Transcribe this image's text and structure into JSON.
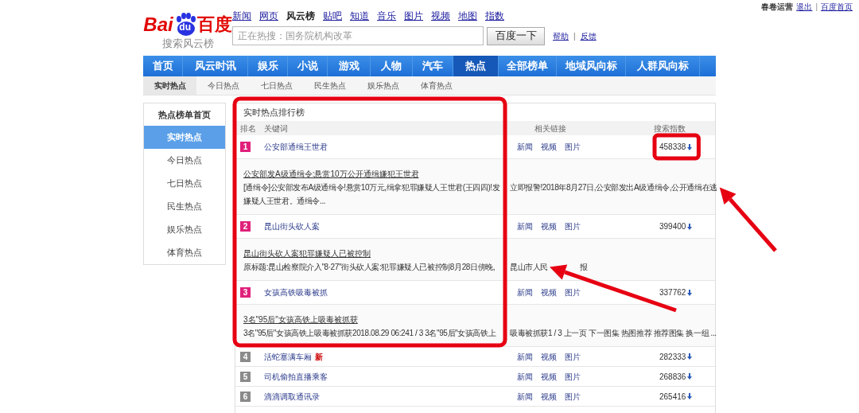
{
  "user_bar": {
    "user": "春卷运营",
    "links": [
      "退出",
      "百度首页"
    ],
    "separator": "|"
  },
  "logo": {
    "left": "Bai",
    "paw": "du",
    "right": "百度",
    "subtitle": "搜索风云榜"
  },
  "top_links": [
    {
      "label": "新闻",
      "selected": false
    },
    {
      "label": "网页",
      "selected": false
    },
    {
      "label": "风云榜",
      "selected": true
    },
    {
      "label": "贴吧",
      "selected": false
    },
    {
      "label": "知道",
      "selected": false
    },
    {
      "label": "音乐",
      "selected": false
    },
    {
      "label": "图片",
      "selected": false
    },
    {
      "label": "视频",
      "selected": false
    },
    {
      "label": "地图",
      "selected": false
    },
    {
      "label": "指数",
      "selected": false
    }
  ],
  "search": {
    "placeholder": "正在热搜：国务院机构改革",
    "button": "百度一下",
    "links": [
      "帮助",
      "反馈"
    ],
    "separator": "|"
  },
  "nav": [
    {
      "label": "首页",
      "selected": false
    },
    {
      "label": "风云时讯",
      "selected": false
    },
    {
      "label": "娱乐",
      "selected": false
    },
    {
      "label": "小说",
      "selected": false
    },
    {
      "label": "游戏",
      "selected": false
    },
    {
      "label": "人物",
      "selected": false
    },
    {
      "label": "汽车",
      "selected": false
    },
    {
      "label": "热点",
      "selected": true
    },
    {
      "label": "全部榜单",
      "selected": false
    },
    {
      "label": "地域风向标",
      "selected": false
    },
    {
      "label": "人群风向标",
      "selected": false
    }
  ],
  "subnav": [
    {
      "label": "实时热点",
      "selected": true
    },
    {
      "label": "今日热点",
      "selected": false
    },
    {
      "label": "七日热点",
      "selected": false
    },
    {
      "label": "民生热点",
      "selected": false
    },
    {
      "label": "娱乐热点",
      "selected": false
    },
    {
      "label": "体育热点",
      "selected": false
    }
  ],
  "sidebar": {
    "title": "热点榜单首页",
    "items": [
      {
        "label": "实时热点",
        "selected": true
      },
      {
        "label": "今日热点",
        "selected": false
      },
      {
        "label": "七日热点",
        "selected": false
      },
      {
        "label": "民生热点",
        "selected": false
      },
      {
        "label": "娱乐热点",
        "selected": false
      },
      {
        "label": "体育热点",
        "selected": false
      }
    ]
  },
  "ranking": {
    "title": "实时热点排行榜",
    "columns": [
      "排名",
      "关键词",
      "相关链接",
      "搜索指数"
    ],
    "rows": [
      {
        "rank": "1",
        "highlighted": true,
        "keyword": "公安部通缉王世君",
        "links": [
          "新闻",
          "视频",
          "图片"
        ],
        "index": "458338",
        "detail": {
          "title": "公安部发A级通缉令:悬赏10万公开通缉嫌犯王世君",
          "lines": [
            [
              "[通缉令]公安部发布A级通缉令!悬赏10万元,缉拿犯罪嫌疑人王世君(王四四)!发",
              "立即报警!2018年8月27日,公安部发出A级通缉令,公开通缉在逃"
            ],
            [
              "嫌疑人王世君。通缉令..."
            ]
          ]
        }
      },
      {
        "rank": "2",
        "highlighted": true,
        "keyword": "昆山街头砍人案",
        "links": [
          "新闻",
          "视频",
          "图片"
        ],
        "index": "399400",
        "detail": {
          "title": "昆山街头砍人案犯罪嫌疑人已被控制",
          "lines": [
            [
              "原标题:昆山检察院介入\"8·27\"街头砍人案:犯罪嫌疑人已被控制8月28日傍晚,",
              "昆山市人民",
              "报"
            ]
          ]
        }
      },
      {
        "rank": "3",
        "highlighted": true,
        "keyword": "女孩高铁吸毒被抓",
        "links": [
          "新闻",
          "视频",
          "图片"
        ],
        "index": "337762",
        "detail": {
          "title": "3名\"95后\"女孩高铁上吸毒被抓获",
          "lines": [
            [
              "3名\"95后\"女孩高铁上吸毒被抓获2018.08.29 06:241 / 3 3名\"95后\"女孩高铁上",
              "吸毒被抓获1 / 3 上一页 下一图集 热图推荐 推荐图集 换一组 ..."
            ]
          ]
        }
      },
      {
        "rank": "4",
        "highlighted": false,
        "keyword": "活蛇塞满车厢",
        "new_badge": "新",
        "links": [
          "新闻",
          "视频",
          "图片"
        ],
        "index": "282333"
      },
      {
        "rank": "5",
        "highlighted": false,
        "keyword": "司机偷拍直播乘客",
        "links": [
          "新闻",
          "视频",
          "图片"
        ],
        "index": "268836"
      },
      {
        "rank": "6",
        "highlighted": false,
        "keyword": "滴滴调取通讯录",
        "links": [
          "新闻",
          "视频",
          "图片"
        ],
        "index": "265416"
      }
    ]
  }
}
